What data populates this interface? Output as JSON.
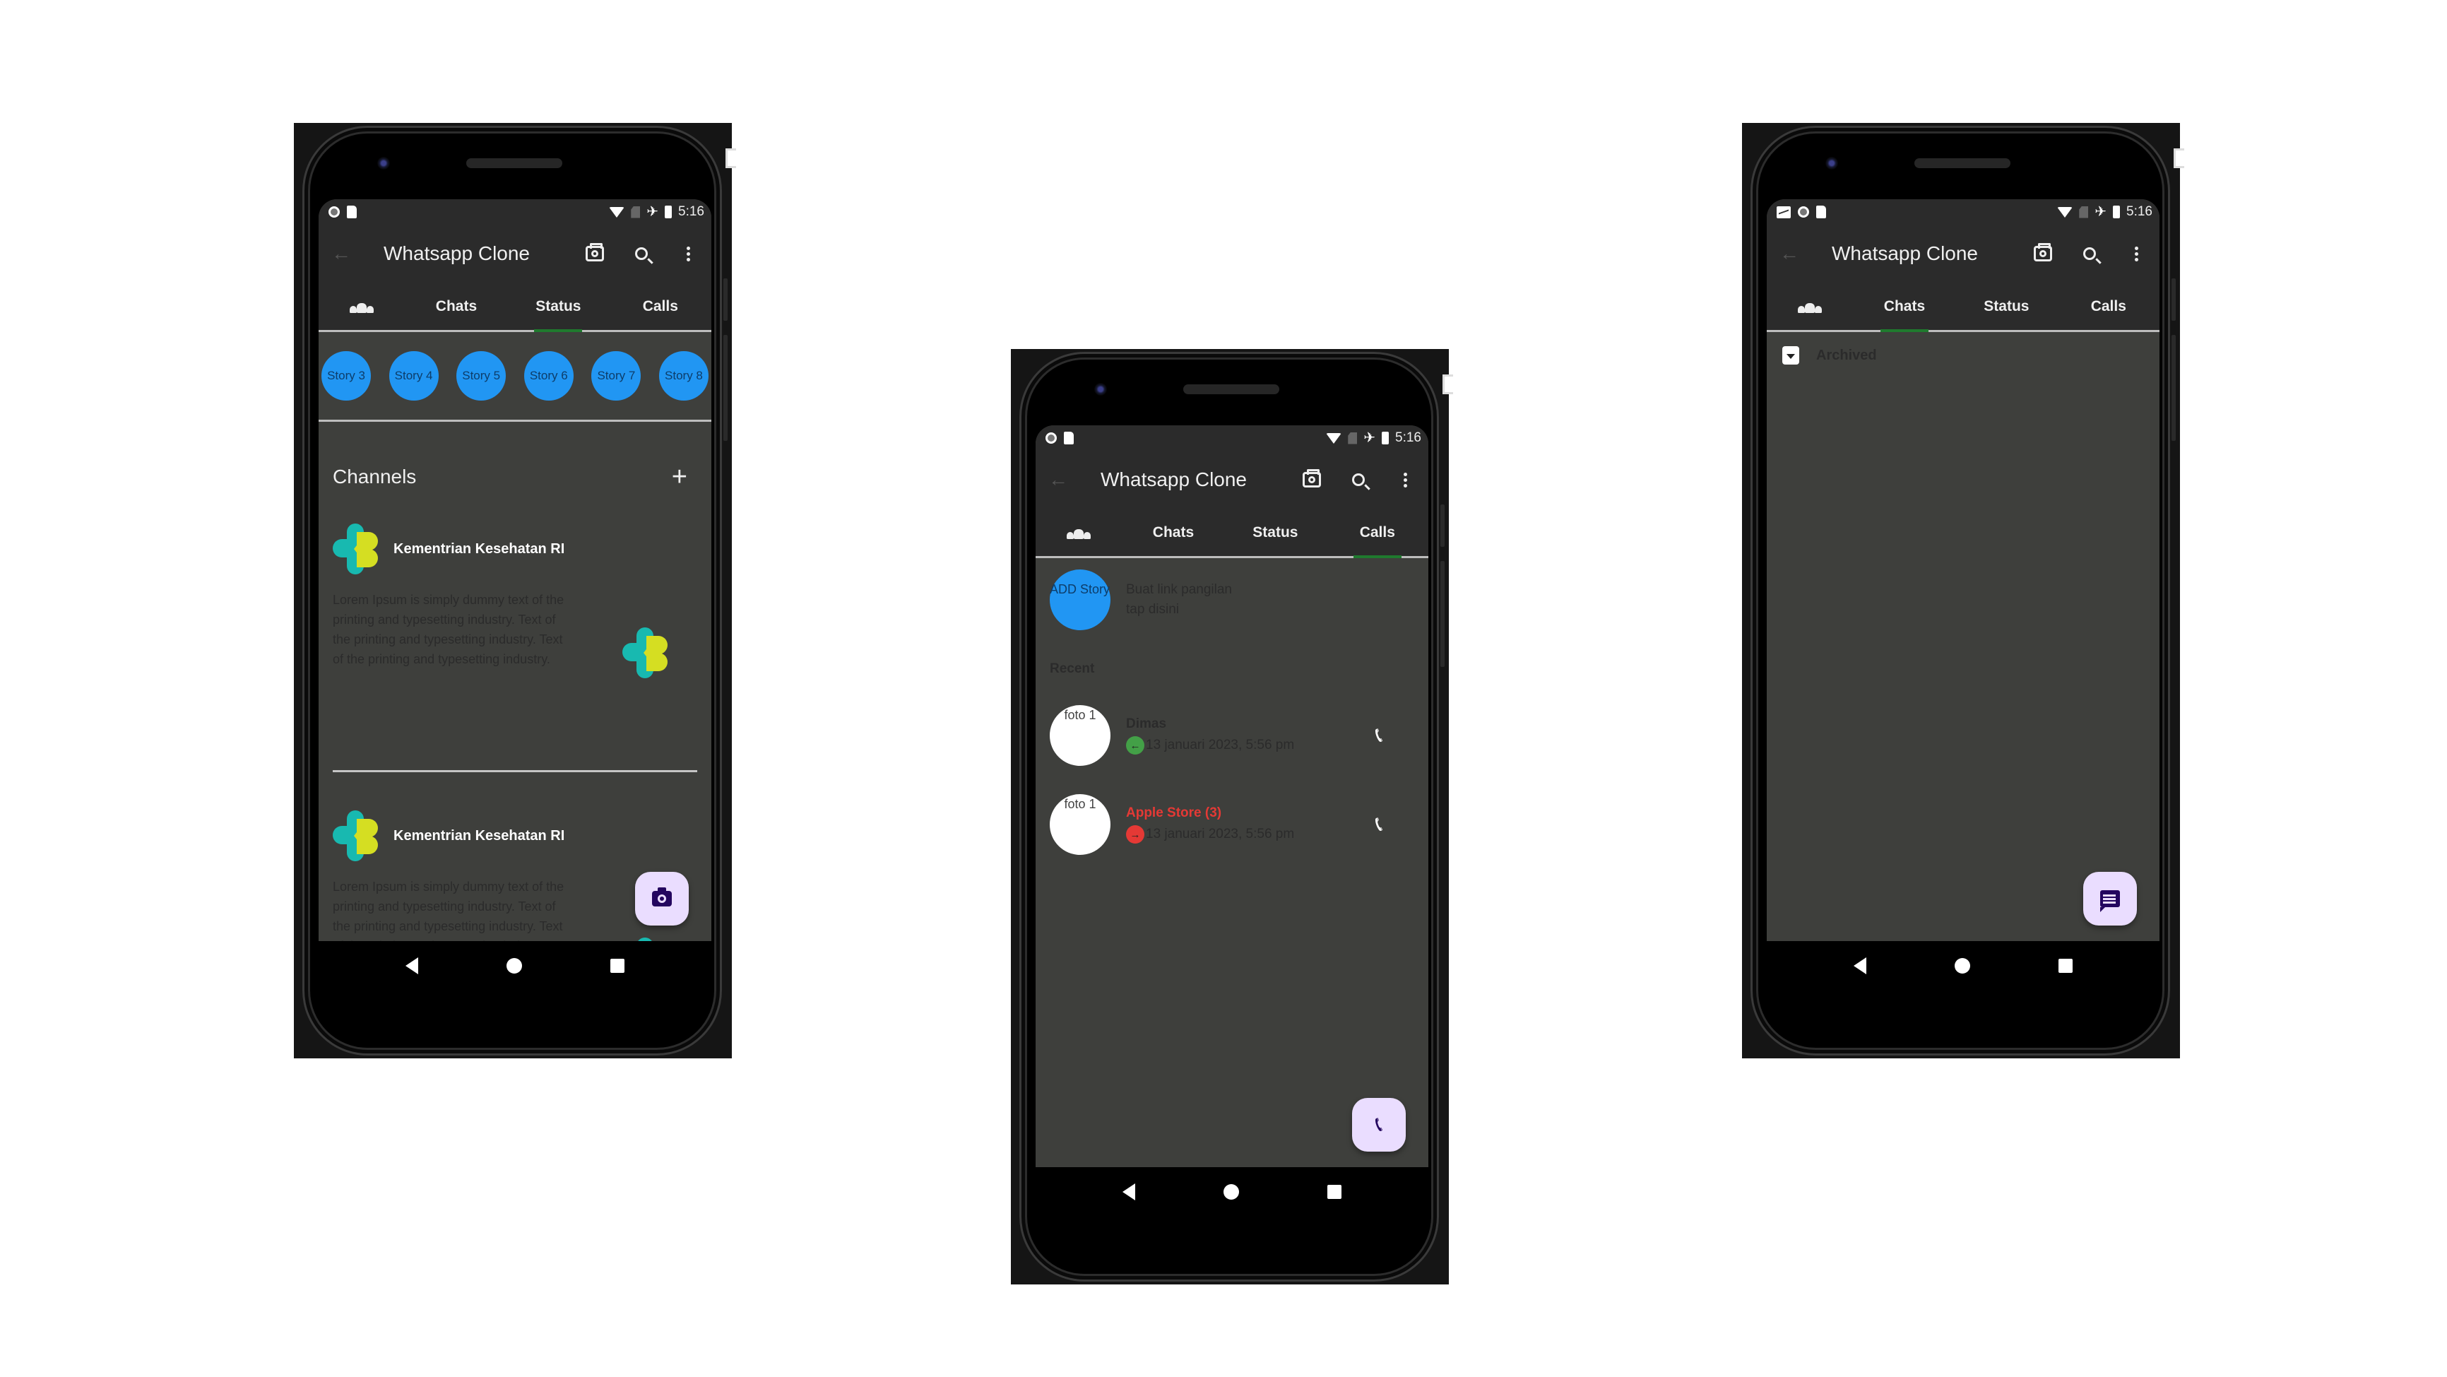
{
  "common": {
    "status_time": "5:16",
    "app_title": "Whatsapp Clone",
    "tabs": [
      "Chats",
      "Status",
      "Calls"
    ],
    "colors": {
      "app_bar": "#2b2b2b",
      "content_bg": "#3e3f3c",
      "tab_indicator": "#1f7a2e",
      "story_circle": "#2196f3",
      "fab_bg": "#eaddff",
      "fab_icon": "#24065f",
      "missed_call": "#e53935",
      "incoming_call": "#43a047"
    }
  },
  "phones": [
    {
      "active_tab": "Status",
      "stories": [
        "Story 3",
        "Story 4",
        "Story 5",
        "Story 6",
        "Story 7",
        "Story 8"
      ],
      "channels_title": "Channels",
      "channels": [
        {
          "name": "Kementrian Kesehatan RI",
          "description": "Lorem Ipsum is simply dummy text of the printing and typesetting industry. Text of the printing and typesetting industry. Text of the printing and typesetting industry."
        },
        {
          "name": "Kementrian Kesehatan RI",
          "description": "Lorem Ipsum is simply dummy text of the printing and typesetting industry. Text of the printing and typesetting industry. Text of the printing and typesetting industry."
        }
      ],
      "fab_icon": "camera-icon"
    },
    {
      "active_tab": "Calls",
      "add_story": {
        "avatar_text": "ADD Story",
        "line1": "Buat link pangilan",
        "line2": "tap disini"
      },
      "recent_label": "Recent",
      "calls": [
        {
          "avatar_text": "foto 1",
          "name": "Dimas",
          "direction": "incoming",
          "timestamp": "13 januari 2023, 5:56 pm",
          "missed": false
        },
        {
          "avatar_text": "foto 1",
          "name": "Apple Store (3)",
          "direction": "outgoing-missed",
          "timestamp": "13 januari 2023, 5:56 pm",
          "missed": true
        }
      ],
      "fab_icon": "phone-icon"
    },
    {
      "active_tab": "Chats",
      "archived_label": "Archived",
      "fab_icon": "chat-icon"
    }
  ]
}
